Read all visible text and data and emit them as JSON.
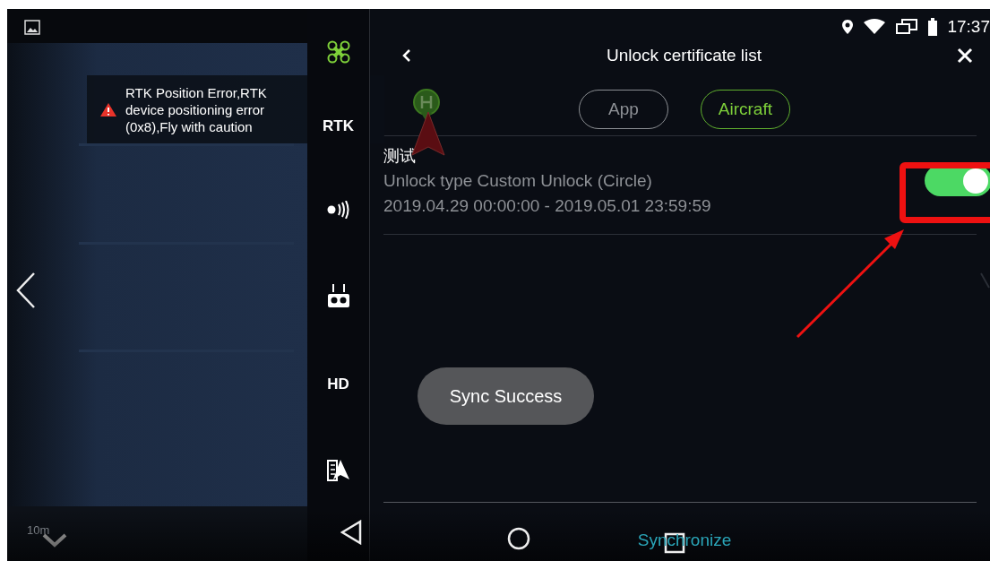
{
  "status_bar": {
    "time": "17:37"
  },
  "header": {
    "title": "Unlock certificate list"
  },
  "tabs": [
    {
      "label": "App",
      "selected": false
    },
    {
      "label": "Aircraft",
      "selected": true
    }
  ],
  "certificates": [
    {
      "name": "测试",
      "unlock_type": "Unlock type Custom Unlock (Circle)",
      "validity": "2019.04.29 00:00:00 - 2019.05.01 23:59:59",
      "on": true
    }
  ],
  "sidebar": {
    "items": [
      {
        "kind": "drone"
      },
      {
        "kind": "text",
        "label": "RTK"
      },
      {
        "kind": "signal"
      },
      {
        "kind": "remote"
      },
      {
        "kind": "text",
        "label": "HD"
      },
      {
        "kind": "map"
      }
    ]
  },
  "warning": {
    "text": "RTK Position Error,RTK device positioning error (0x8),Fly with caution"
  },
  "map": {
    "scale": "10m"
  },
  "toast": {
    "text": "Sync Success"
  },
  "sync_button": {
    "label": "Synchronize"
  }
}
